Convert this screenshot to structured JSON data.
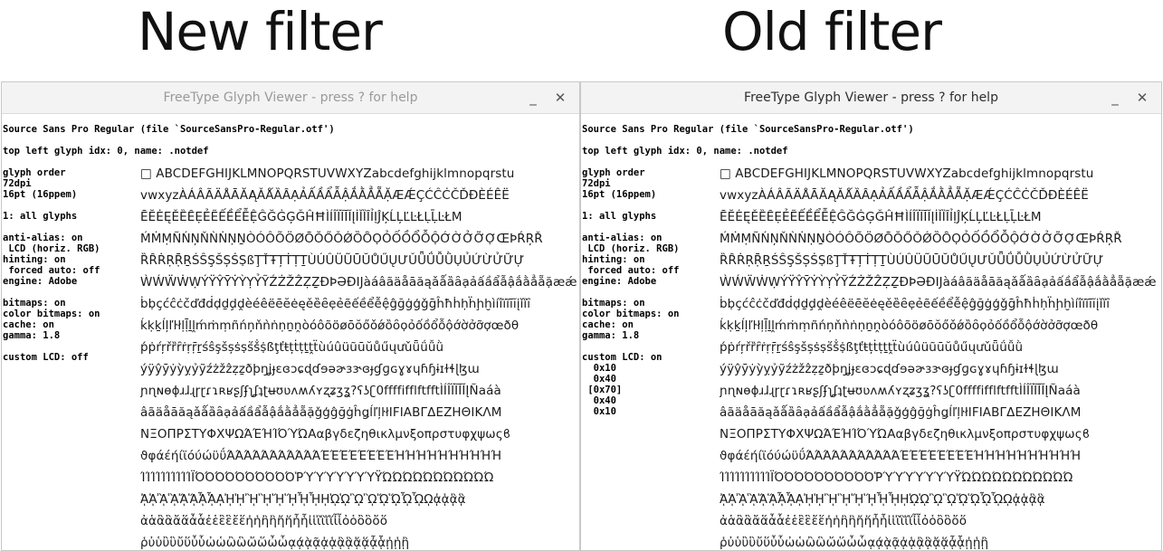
{
  "headlines": {
    "new": "New filter",
    "old": "Old filter"
  },
  "windows": {
    "new": {
      "title": "FreeType Glyph Viewer - press ? for help",
      "minimize": "_",
      "close": "✕",
      "file_line": "Source Sans Pro Regular (file `SourceSansPro-Regular.otf')",
      "glyph_index_line": "top left glyph idx: 0, name: .notdef",
      "info_lines": [
        "glyph order",
        "72dpi",
        "16pt (16ppem)",
        "",
        "1: all glyphs",
        "",
        "anti-alias: on",
        " LCD (horiz. RGB)",
        "hinting: on",
        " forced auto: off",
        "engine: Adobe",
        "",
        "bitmaps: on",
        "color bitmaps: on",
        "cache: on",
        "gamma: 1.8",
        "",
        "custom LCD: off"
      ]
    },
    "old": {
      "title": "FreeType Glyph Viewer - press ? for help",
      "minimize": "_",
      "close": "✕",
      "file_line": "Source Sans Pro Regular (file `SourceSansPro-Regular.otf')",
      "glyph_index_line": "top left glyph idx: 0, name: .notdef",
      "info_lines": [
        "glyph order",
        "72dpi",
        "16pt (16ppem)",
        "",
        "1: all glyphs",
        "",
        "anti-alias: on",
        " LCD (horiz. RGB)",
        "hinting: on",
        " forced auto: off",
        "engine: Adobe",
        "",
        "bitmaps: on",
        "color bitmaps: on",
        "cache: on",
        "gamma: 1.8",
        "",
        "custom LCD: on",
        "  0x10",
        "  0x40",
        " [0x70]",
        "  0x40",
        "  0x10"
      ]
    }
  },
  "glyph_rows": [
    "□ ABCDEFGHIJKLMNOPQRSTUVWXYZabcdefghijklmnopqrstu",
    "vwxyzÀÁÂÃÄÅĀĂĄǍǺȀȂẠẢẤẦẨẪẬẮẰẲẴẶÆǼÇĆĈĊČĎĐÈÉÊË",
    "ĒĔĖĘĚȄȆẸẺẼẾỀỂỄỆĜĞĠĢǦĤĦÌÍÎÏĨĪĬĮİǏȈȊỈỊĴĶĹĻĽĿŁḶḸĿŁM",
    "ḾṀṂÑŃŅŇǸṄṆṈÒÓÔÕÖØŌŎŐǑǾȌȎỌỎỐỒỔỖỘỚỜỞỠỢŒÞŔŖŘ",
    "ȐȒṘṚṜṞŚŜŞŠȘṠṢßŢŤŦȚṪṬṮÙÚÛÜŨŪŬŮŰŲƯǓǕǗǙǛỤỦỨỪỬỮỰ",
    "ẀẂẄẆẈÝŸŶȲẎỲỴỶỸŹŻŽẐẒẔÐÞƏĐĲàáâãäåāăąǎǻȁȃạảấầẩẫậắằẳẵặæǽ",
    "ḃḅçćĉċčďđḋḍḏḑḓèéêëēĕėęěȅȇẹẻẽếềểễệĝğġģǧḡĥħḣḥḧḩḫìíîïĩīĭįǐȉȋ",
    "ḱḳḵĺļľŀłḷḹḻḽḿṁṃñńņňǹṅṇṉṋòóôõöøōŏőǒǿȍȏọỏốồổỗộớờởỡợœðθ",
    "ṕṗŕŗřȑȓṙṛṝṟśŝşšșṡṣṥṧṩßţťŧțṫṭṯṱẗùúûüũūŭůűųưǔǖǘǚǜ",
    "ýÿŷȳẏỳỵỷỹźżžẑẓẕðþŋʝɟɛɞɔɕɖɗɘəɚɜɝɞɟɠɡɢɣɤɥɦɧɨɪɫɬɭɮɯ",
    "ɲɳɴɵɸɹɺɻɼɽɾɿʀʁʂʃʄʅʆʇʈʉʊʋʌʍʎʏʐʑʒʓ?ʕʖʗ0ffffifflftfftÌÍÎÏĨĪĬĮÑaáà",
    "âãäåāăąǎǻȁȃạảấầẩẫậắằẳẵặǧģĝğġĥǥĺľļŀłIFIABΓΔΕΖΗΘΙΚΛΜ",
    "ΝΞΟΠΡΣΤΥΦΧΨΩΆΈΉΊΌΎΏΑαβγδεζηθικλμνξοπρστυφχψωςϐ",
    "ϑφάέήίϊόύώϋΰΆΆΆΆΆΆΆΆΆΆΆΈΈΈΈΈΈΈΈΉΉΉΉΉΉΉΉΉΉ",
    "ΊΊΊΊΊΊΊΊΊΊΪΌΌΌΌΌΌΌΌΌΌῬΎΎΎΎΎΎΎΫΏΏΏΏΏΏΏΏΏΏΏ",
    "ᾈᾉᾊᾋᾌᾍᾎᾏᾼᾘᾙᾚᾛᾜᾝᾞᾟῌᾨᾩᾪᾫᾬᾭᾮᾯῼᾀᾁᾂᾃ",
    "ἀἁἂἃἄἅἆἇἐἑἒἓἔἕἠἡἢἣἤἥἦἧἰἱἲἳἴἵἶἷὀὁὂὃὄὅ",
    "ῥὐὑὒὓὔὕὖὗὠὡὢὣὤὥὦὧᾳᾴᾲᾷᾀᾁᾂᾃᾄᾅᾆᾇᾐᾑᾒ"
  ]
}
